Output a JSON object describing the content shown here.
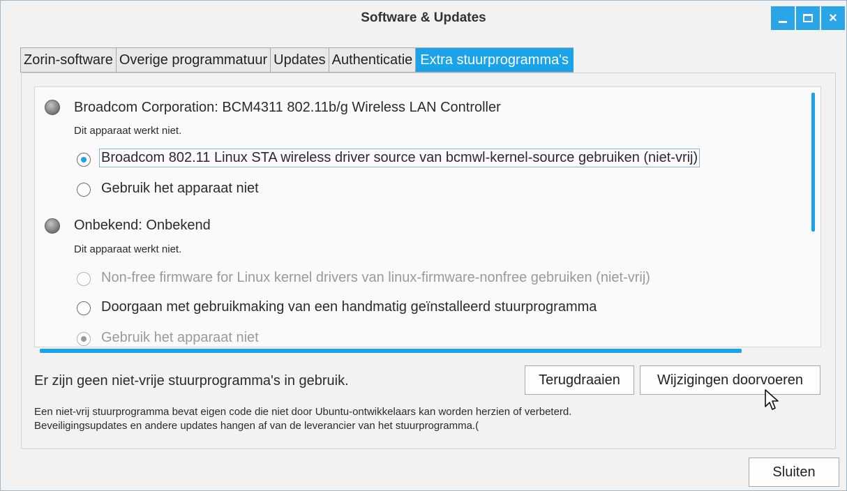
{
  "window": {
    "title": "Software & Updates",
    "controls": {
      "minimize": "minimize-icon",
      "maximize": "maximize-icon",
      "close": "close-icon"
    }
  },
  "tabs": [
    {
      "label": "Zorin-software",
      "active": false
    },
    {
      "label": "Overige programmatuur",
      "active": false
    },
    {
      "label": "Updates",
      "active": false
    },
    {
      "label": "Authenticatie",
      "active": false
    },
    {
      "label": "Extra stuurprogramma's",
      "active": true
    }
  ],
  "devices": [
    {
      "title": "Broadcom Corporation: BCM4311 802.11b/g Wireless LAN Controller",
      "status": "Dit apparaat werkt niet.",
      "options": [
        {
          "label": "Broadcom 802.11 Linux STA wireless driver source van bcmwl-kernel-source gebruiken (niet-vrij)",
          "checked": true,
          "disabled": false
        },
        {
          "label": "Gebruik het apparaat niet",
          "checked": false,
          "disabled": false
        }
      ]
    },
    {
      "title": "Onbekend: Onbekend",
      "status": "Dit apparaat werkt niet.",
      "options": [
        {
          "label": "Non-free firmware for Linux kernel drivers van linux-firmware-nonfree gebruiken (niet-vrij)",
          "checked": false,
          "disabled": true
        },
        {
          "label": "Doorgaan met gebruikmaking van een handmatig geïnstalleerd stuurprogramma",
          "checked": false,
          "disabled": false
        },
        {
          "label": "Gebruik het apparaat niet",
          "checked": true,
          "disabled": true
        }
      ]
    }
  ],
  "footer": {
    "status": "Er zijn geen niet-vrije stuurprogramma's in gebruik.",
    "revert_label": "Terugdraaien",
    "apply_label": "Wijzigingen doorvoeren",
    "info_line1": "Een niet-vrij stuurprogramma bevat eigen code die niet door Ubuntu-ontwikkelaars kan worden herzien of verbeterd.",
    "info_line2": "Beveiligingsupdates en andere updates hangen af van de leverancier van het stuurprogramma.(",
    "close_label": "Sluiten"
  },
  "colors": {
    "accent": "#1aa3e8",
    "window_bg": "#f2f2f2",
    "disabled_text": "#9a9a9a"
  }
}
